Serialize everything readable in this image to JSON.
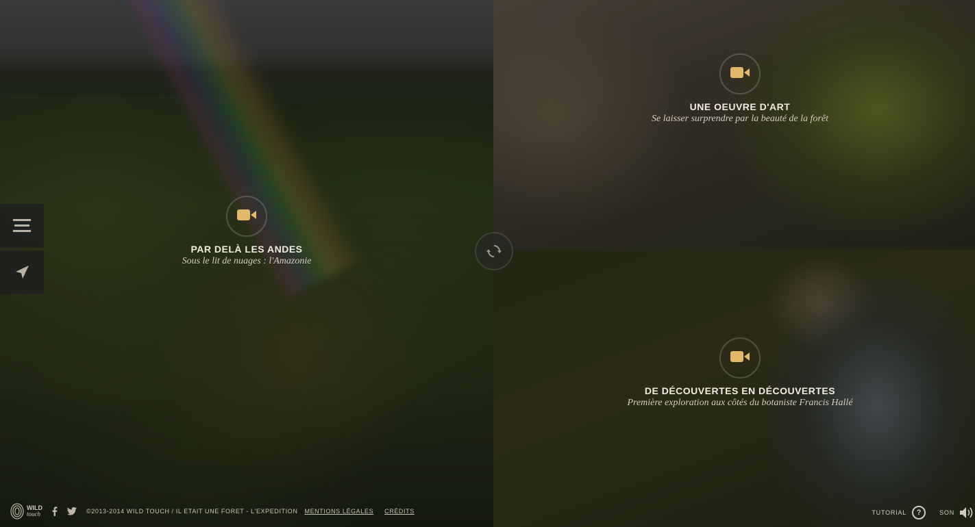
{
  "colors": {
    "accent": "#e2b86a",
    "text": "#f2ece0",
    "subtext": "#d3ccbc"
  },
  "hotspots": [
    {
      "title": "PAR DELÀ LES ANDES",
      "subtitle": "Sous le lit de nuages : l'Amazonie",
      "icon": "video-camera-icon"
    },
    {
      "title": "UNE OEUVRE D'ART",
      "subtitle": "Se laisser surprendre par la beauté de la forêt",
      "icon": "video-camera-icon"
    },
    {
      "title": "DE DÉCOUVERTES EN DÉCOUVERTES",
      "subtitle": "Première exploration aux côtés du botaniste Francis Hallé",
      "icon": "video-camera-icon"
    }
  ],
  "sidebar": {
    "menu_icon": "hamburger-menu-icon",
    "navigate_icon": "navigation-arrow-icon"
  },
  "center": {
    "refresh_icon": "refresh-icon"
  },
  "footer": {
    "logo_line1": "WILD",
    "logo_line2": "touch",
    "copyright": "©2013-2014 WILD TOUCH / IL ETAIT UNE FORET - L'EXPEDITION",
    "legal_link": "MENTIONS LÉGALES",
    "credits_link": "CRÉDITS",
    "tutorial_label": "TUTORIAL",
    "help_symbol": "?",
    "sound_label": "SON"
  }
}
